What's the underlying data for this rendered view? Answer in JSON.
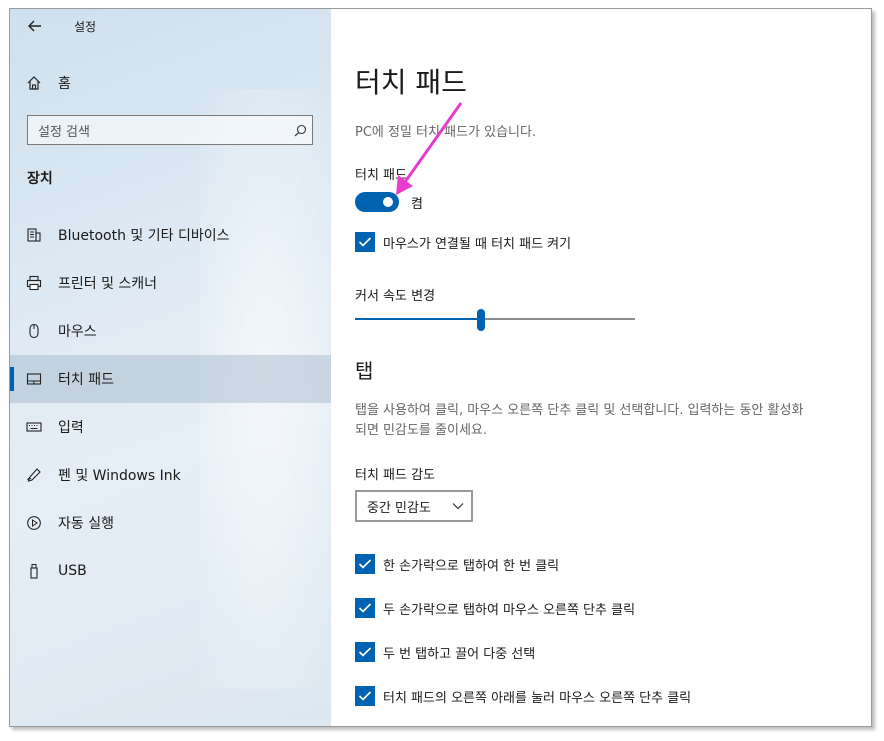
{
  "sidebar": {
    "app_title": "설정",
    "home_label": "홈",
    "search_placeholder": "설정 검색",
    "section_title": "장치",
    "items": [
      {
        "label": "Bluetooth 및 기타 디바이스",
        "icon": "bluetooth-devices-icon"
      },
      {
        "label": "프린터 및 스캐너",
        "icon": "printer-icon"
      },
      {
        "label": "마우스",
        "icon": "mouse-icon"
      },
      {
        "label": "터치 패드",
        "icon": "touchpad-icon",
        "active": true
      },
      {
        "label": "입력",
        "icon": "keyboard-icon"
      },
      {
        "label": "펜 및 Windows Ink",
        "icon": "pen-icon"
      },
      {
        "label": "자동 실행",
        "icon": "autoplay-icon"
      },
      {
        "label": "USB",
        "icon": "usb-icon"
      }
    ]
  },
  "main": {
    "title": "터치 패드",
    "description": "PC에 정밀 터치 패드가 있습니다.",
    "touchpad_label": "터치 패드",
    "touchpad_toggle_state": "켬",
    "mouse_connected_label": "마우스가 연결될 때 터치 패드 켜기",
    "cursor_speed_label": "커서 속도 변경",
    "cursor_speed_value": 0.45,
    "tap_heading": "탭",
    "tap_description": "탭을 사용하여 클릭, 마우스 오른쪽 단추 클릭 및 선택합니다. 입력하는 동안 활성화되면 민감도를 줄이세요.",
    "sensitivity_label": "터치 패드 감도",
    "sensitivity_value": "중간 민감도",
    "options": [
      "한 손가락으로 탭하여 한 번 클릭",
      "두 손가락으로 탭하여 마우스 오른쪽 단추 클릭",
      "두 번 탭하고 끌어 다중 선택",
      "터치 패드의 오른쪽 아래를 눌러 마우스 오른쪽 단추 클릭"
    ]
  },
  "colors": {
    "accent": "#0063b1",
    "annotation_arrow": "#e83bd0"
  }
}
